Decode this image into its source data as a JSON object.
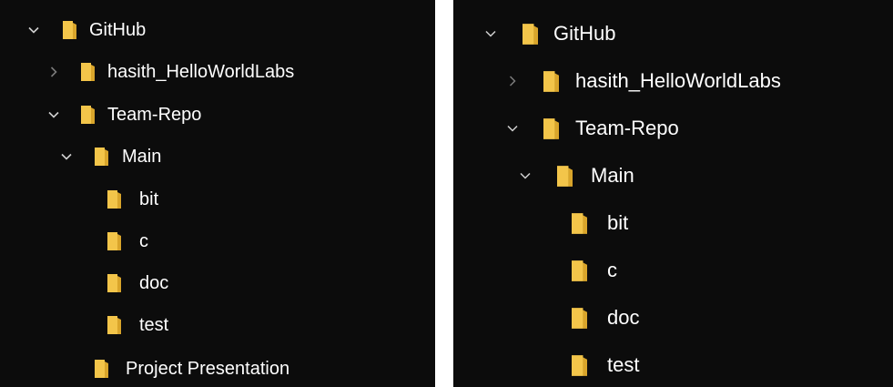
{
  "left_tree": {
    "items": [
      {
        "label": "GitHub",
        "state": "expanded"
      },
      {
        "label": "hasith_HelloWorldLabs",
        "state": "collapsed"
      },
      {
        "label": "Team-Repo",
        "state": "expanded"
      },
      {
        "label": "Main",
        "state": "expanded"
      },
      {
        "label": "bit",
        "state": "leaf"
      },
      {
        "label": "c",
        "state": "leaf"
      },
      {
        "label": "doc",
        "state": "leaf"
      },
      {
        "label": "test",
        "state": "leaf"
      },
      {
        "label": "Project Presentation",
        "state": "leaf"
      }
    ]
  },
  "right_tree": {
    "items": [
      {
        "label": "GitHub",
        "state": "expanded"
      },
      {
        "label": "hasith_HelloWorldLabs",
        "state": "collapsed"
      },
      {
        "label": "Team-Repo",
        "state": "expanded"
      },
      {
        "label": "Main",
        "state": "expanded"
      },
      {
        "label": "bit",
        "state": "leaf"
      },
      {
        "label": "c",
        "state": "leaf"
      },
      {
        "label": "doc",
        "state": "leaf"
      },
      {
        "label": "test",
        "state": "leaf"
      }
    ]
  },
  "colors": {
    "background": "#0c0c0c",
    "folder": "#f3c54a",
    "folder_shadow": "#d9a52b",
    "chevron_expanded": "#d0d0d0",
    "chevron_collapsed": "#7a7a7a",
    "text": "#ffffff"
  },
  "icons": {
    "expanded": "chevron-down-icon",
    "collapsed": "chevron-right-icon",
    "folder": "folder-icon"
  }
}
